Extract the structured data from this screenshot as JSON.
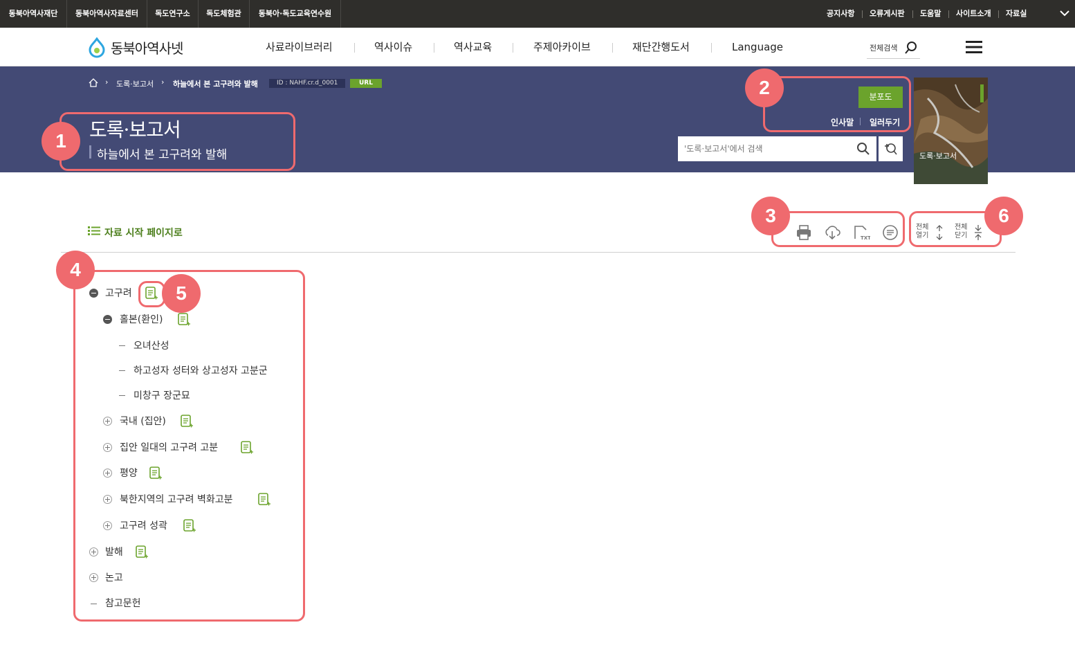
{
  "topbar": {
    "sites": [
      "동북아역사재단",
      "동북아역사자료센터",
      "독도연구소",
      "독도체험관",
      "동북아·독도교육연수원"
    ],
    "utility": [
      "공지사항",
      "오류게시판",
      "도움말",
      "사이트소개",
      "자료실"
    ]
  },
  "header": {
    "logo_text": "동북아역사넷",
    "menu": [
      "사료라이브러리",
      "역사이슈",
      "역사교육",
      "주제아카이브",
      "재단간행도서",
      "Language"
    ],
    "search_label": "전체검색"
  },
  "breadcrumb": {
    "items": [
      "도록·보고서",
      "하늘에서 본 고구려와 발해"
    ],
    "id_label": "ID : NAHF.cr.d_0001",
    "url_label": "URL"
  },
  "title": {
    "main": "도록·보고서",
    "sub": "하늘에서 본 고구려와 발해"
  },
  "side": {
    "map_button": "분포도",
    "links": [
      "인사말",
      "일러두기"
    ],
    "search_placeholder": "'도록·보고서'에서 검색",
    "cover_title": "도록·보고서"
  },
  "toolbar": {
    "back_to_start": "자료 시작 페이지로",
    "expand_all": [
      "전체",
      "열기"
    ],
    "collapse_all": [
      "전체",
      "닫기"
    ],
    "txt_label": "TXT"
  },
  "tree": {
    "goguryeo": "고구려",
    "holbon": "홀본(환인)",
    "onyeo": "오녀산성",
    "hagoseong": "하고성자 성터와 상고성자 고분군",
    "michang": "미창구 장군묘",
    "gungnae": "국내 (집안)",
    "jipan": "집안 일대의 고구려 고분",
    "pyeongyang": "평양",
    "bukhan": "북한지역의 고구려 벽화고분",
    "seonggwak": "고구려 성곽",
    "balhae": "발해",
    "nongo": "논고",
    "chamgo": "참고문헌"
  },
  "annotations": [
    "1",
    "2",
    "3",
    "4",
    "5",
    "6"
  ],
  "colors": {
    "band": "#434a75",
    "accent_green": "#6ba32c",
    "annotation": "#ef6a6e",
    "topbar": "#2f2e2b"
  }
}
